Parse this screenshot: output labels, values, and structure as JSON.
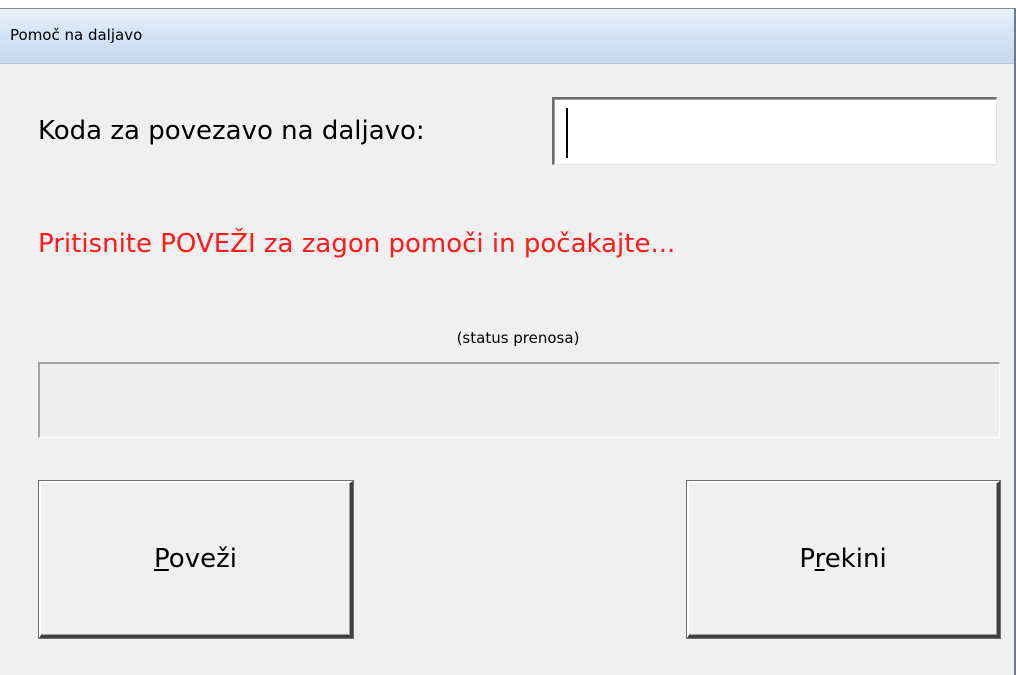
{
  "window": {
    "title": "Pomoč na daljavo"
  },
  "form": {
    "code_label": "Koda za povezavo na daljavo:",
    "code_value": "",
    "instruction": "Pritisnite POVEŽI za zagon pomoči in počakajte...",
    "instruction_color": "#ff1a1a",
    "status_caption": "(status prenosa)",
    "progress": 0
  },
  "buttons": {
    "connect": {
      "mnemonic": "P",
      "rest": "oveži"
    },
    "abort": {
      "pre": "P",
      "mnemonic": "r",
      "rest": "ekini"
    }
  }
}
